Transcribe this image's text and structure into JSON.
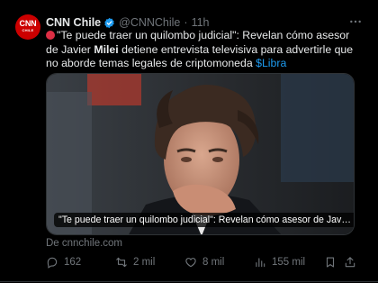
{
  "author": {
    "name": "CNN Chile",
    "handle": "@CNNChile",
    "separator": "·",
    "time": "11h",
    "avatar_text": "CNN",
    "avatar_subtext": "CHILE"
  },
  "tweet": {
    "emoji": "red-circle",
    "text_main": "\"Te puede traer un quilombo judicial\": Revelan cómo asesor de Javier ",
    "text_bold": "Milei",
    "text_rest": " detiene entrevista televisiva para advertirle que no aborde temas legales de criptomoneda ",
    "cashtag": "$Libra"
  },
  "card": {
    "headline": "\"Te puede traer un quilombo judicial\": Revelan cómo asesor de Javier Milei det...",
    "source": "De cnnchile.com"
  },
  "actions": {
    "replies": "162",
    "retweets": "2 mil",
    "likes": "8 mil",
    "views": "155 mil"
  },
  "colors": {
    "background": "#000000",
    "text": "#e7e9ea",
    "muted": "#71767b",
    "accent": "#1d9bf0",
    "brand": "#cc0000"
  }
}
